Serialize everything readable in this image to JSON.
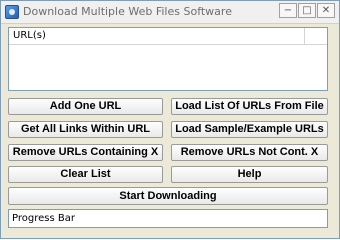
{
  "window": {
    "title": "Download Multiple Web Files Software",
    "min_glyph": "−",
    "max_glyph": "□",
    "close_glyph": "✕"
  },
  "url_list": {
    "column_header": "URL(s)",
    "rows": []
  },
  "buttons": {
    "add_one_url": "Add One URL",
    "load_list_from_file": "Load List Of URLs From File",
    "get_all_links": "Get All Links Within URL",
    "load_sample": "Load Sample/Example URLs",
    "remove_containing": "Remove URLs Containing X",
    "remove_not_containing": "Remove URLs Not Cont. X",
    "clear_list": "Clear List",
    "help": "Help",
    "start_downloading": "Start Downloading"
  },
  "progress": {
    "text": "Progress Bar"
  }
}
